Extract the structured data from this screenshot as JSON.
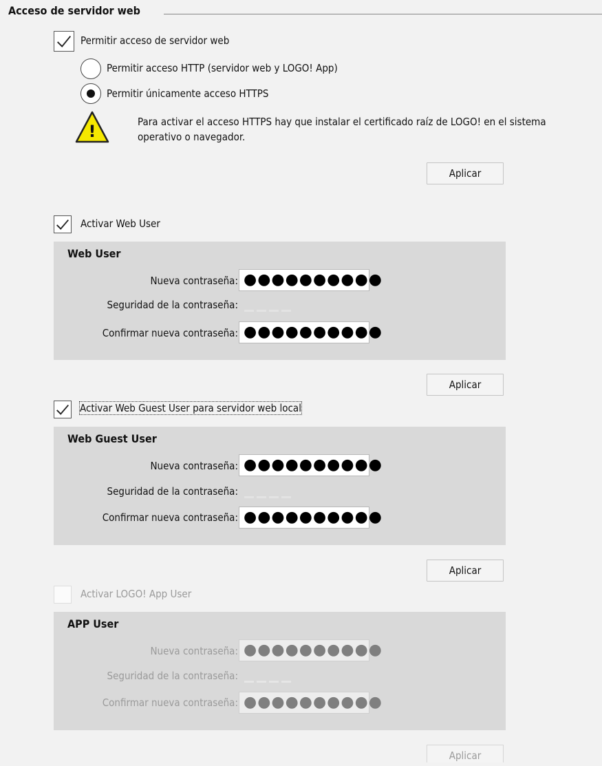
{
  "section": {
    "title": "Acceso de servidor web"
  },
  "webserver": {
    "allow_label": "Permitir acceso de servidor web",
    "allow_checked": true,
    "radio_http_label": "Permitir acceso HTTP (servidor web y LOGO! App)",
    "radio_https_label": "Permitir únicamente acceso HTTPS",
    "selected_option": "https",
    "warning_text": "Para activar el acceso HTTPS hay que instalar el certificado raíz de LOGO! en el sistema operativo o navegador.",
    "apply_label": "Aplicar"
  },
  "web_user": {
    "enable_label": "Activar Web User",
    "enabled": true,
    "panel_title": "Web User",
    "new_password_label": "Nueva contraseña:",
    "new_password_value": "●●●●●●●●●●",
    "strength_label": "Seguridad de la contraseña:",
    "confirm_label": "Confirmar nueva contraseña:",
    "confirm_value": "●●●●●●●●●●",
    "apply_label": "Aplicar"
  },
  "web_guest_user": {
    "enable_label": "Activar Web Guest User para servidor web local",
    "enabled": true,
    "panel_title": "Web Guest User",
    "new_password_label": "Nueva contraseña:",
    "new_password_value": "●●●●●●●●●●",
    "strength_label": "Seguridad de la contraseña:",
    "confirm_label": "Confirmar nueva contraseña:",
    "confirm_value": "●●●●●●●●●●",
    "apply_label": "Aplicar"
  },
  "app_user": {
    "enable_label": "Activar LOGO! App User",
    "enabled": false,
    "panel_title": "APP User",
    "new_password_label": "Nueva contraseña:",
    "new_password_value": "●●●●●●●●●●",
    "strength_label": "Seguridad de la contraseña:",
    "confirm_label": "Confirmar nueva contraseña:",
    "confirm_value": "●●●●●●●●●●",
    "apply_label": "Aplicar"
  },
  "icons": {
    "check": "checkmark-icon",
    "warning": "warning-triangle-icon"
  },
  "colors": {
    "background": "#f2f2f2",
    "panel": "#d9d9d9",
    "warning_yellow": "#f5e800",
    "disabled_text": "#9a9a9a"
  }
}
